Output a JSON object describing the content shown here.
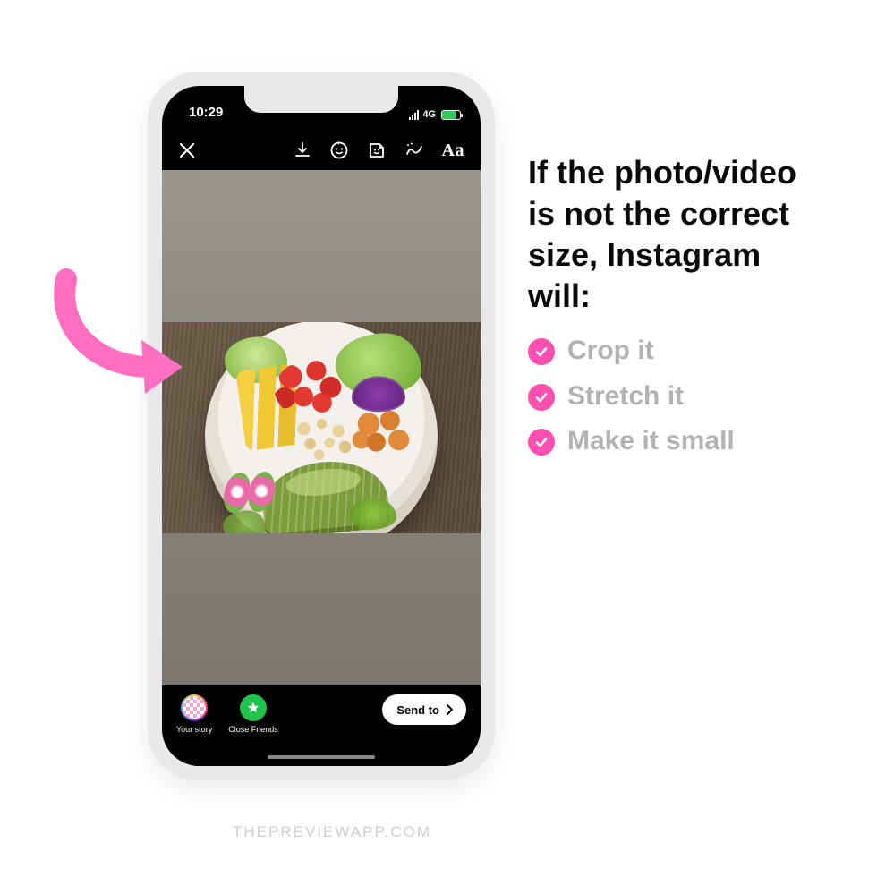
{
  "statusbar": {
    "time": "10:29",
    "cell_label": "4G"
  },
  "toolbar": {
    "text_tool": "Aa"
  },
  "bottombar": {
    "your_story": "Your story",
    "close_friends": "Close Friends",
    "send": "Send to"
  },
  "copy": {
    "heading": "If the photo/video is not the correct size, Instagram will:",
    "bullets": [
      "Crop it",
      "Stretch it",
      "Make it small"
    ]
  },
  "watermark": "THEPREVIEWAPP.COM",
  "colors": {
    "accent_pink": "#ff4fb0"
  }
}
